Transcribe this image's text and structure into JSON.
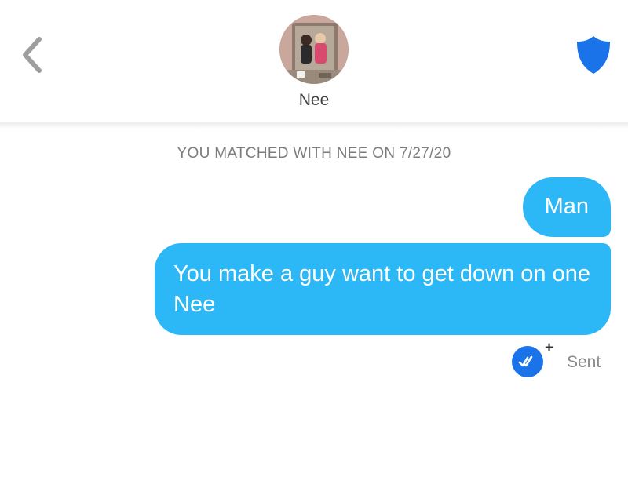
{
  "header": {
    "back_icon": "chevron-left-icon",
    "match_name": "Nee",
    "safety_icon": "shield-icon",
    "accent_color": "#1a73e8"
  },
  "conversation": {
    "match_banner": "YOU MATCHED WITH NEE ON 7/27/20",
    "bubble_color": "#2cb8f6",
    "messages": [
      {
        "text": "Man"
      },
      {
        "text": "You make a guy want to get down on one Nee"
      }
    ],
    "receipt": {
      "icon": "read-receipt-icon",
      "plus": "+",
      "status": "Sent"
    }
  }
}
